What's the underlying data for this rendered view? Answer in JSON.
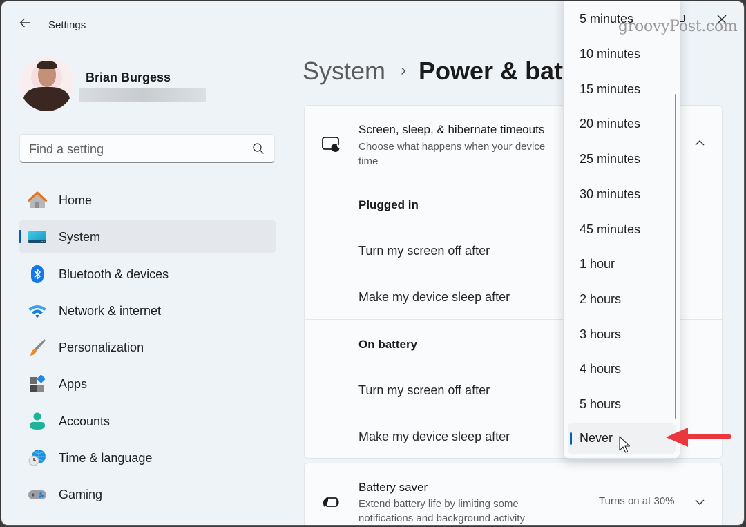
{
  "window": {
    "app_title": "Settings",
    "watermark": "groovyPost.com"
  },
  "user": {
    "name": "Brian Burgess"
  },
  "search": {
    "placeholder": "Find a setting"
  },
  "sidebar": {
    "items": [
      {
        "label": "Home",
        "icon": "home-icon",
        "active": false
      },
      {
        "label": "System",
        "icon": "system-icon",
        "active": true
      },
      {
        "label": "Bluetooth & devices",
        "icon": "bluetooth-icon",
        "active": false
      },
      {
        "label": "Network & internet",
        "icon": "wifi-icon",
        "active": false
      },
      {
        "label": "Personalization",
        "icon": "paintbrush-icon",
        "active": false
      },
      {
        "label": "Apps",
        "icon": "apps-icon",
        "active": false
      },
      {
        "label": "Accounts",
        "icon": "accounts-icon",
        "active": false
      },
      {
        "label": "Time & language",
        "icon": "globe-clock-icon",
        "active": false
      },
      {
        "label": "Gaming",
        "icon": "gamepad-icon",
        "active": false
      }
    ]
  },
  "breadcrumb": {
    "parent": "System",
    "separator": "›",
    "current": "Power & battery"
  },
  "timeouts_card": {
    "title": "Screen, sleep, & hibernate timeouts",
    "description": "Choose what happens when your device is idle for some time",
    "description_visible_line1": "Choose what happens when your device",
    "description_visible_line2": "time",
    "expanded": true,
    "sections": [
      {
        "heading": "Plugged in",
        "rows": [
          {
            "label": "Turn my screen off after"
          },
          {
            "label": "Make my device sleep after"
          }
        ]
      },
      {
        "heading": "On battery",
        "rows": [
          {
            "label": "Turn my screen off after"
          },
          {
            "label": "Make my device sleep after"
          }
        ]
      }
    ]
  },
  "battery_saver_card": {
    "title": "Battery saver",
    "description_line1": "Extend battery life by limiting some",
    "description_line2": "notifications and background activity",
    "status": "Turns on at 30%"
  },
  "dropdown": {
    "options": [
      "5 minutes",
      "10 minutes",
      "15 minutes",
      "20 minutes",
      "25 minutes",
      "30 minutes",
      "45 minutes",
      "1 hour",
      "2 hours",
      "3 hours",
      "4 hours",
      "5 hours",
      "Never"
    ],
    "selected": "Never"
  },
  "colors": {
    "accent": "#005fb8",
    "annotation_arrow": "#e8383d",
    "window_bg": "#eef3f8",
    "card_bg": "#fafbfc"
  }
}
